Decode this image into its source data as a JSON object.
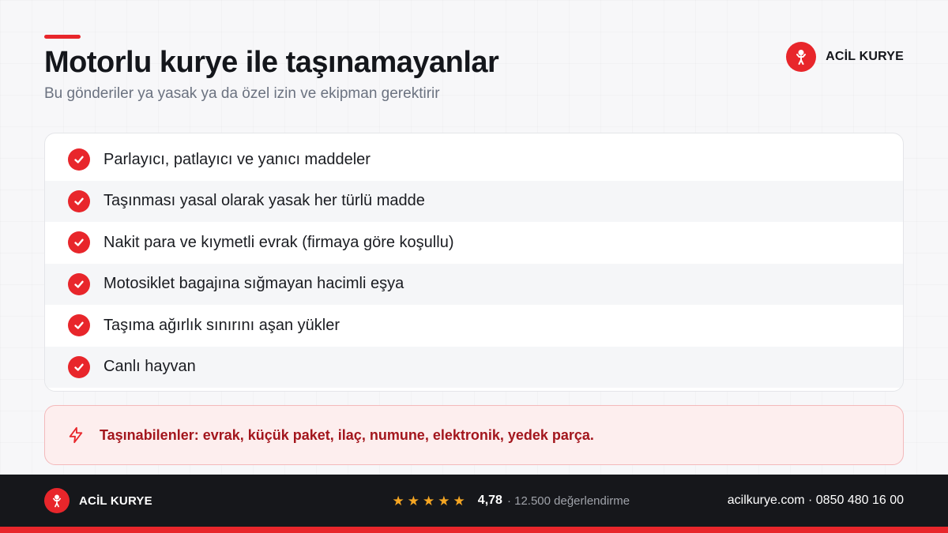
{
  "header": {
    "title": "Motorlu kurye ile taşınamayanlar",
    "subtitle": "Bu gönderiler ya yasak ya da özel izin ve ekipman gerektirir"
  },
  "brand": {
    "name": "ACİL KURYE",
    "logo_icon": "courier-person-icon"
  },
  "list": {
    "items": [
      "Parlayıcı, patlayıcı ve yanıcı maddeler",
      "Taşınması yasal olarak yasak her türlü madde",
      "Nakit para ve kıymetli evrak (firmaya göre koşullu)",
      "Motosiklet bagajına sığmayan hacimli eşya",
      "Taşıma ağırlık sınırını aşan yükler",
      "Canlı hayvan"
    ],
    "item_icon": "check-circle-icon"
  },
  "note": {
    "icon": "lightning-bolt-icon",
    "text": "Taşınabilenler: evrak, küçük paket, ilaç, numune, elektronik, yedek parça."
  },
  "footer": {
    "brand_name": "ACİL KURYE",
    "rating_stars": 5,
    "rating_value": "4,78",
    "rating_count": "· 12.500 değerlendirme",
    "contact": "acilkurye.com · 0850 480 16 00"
  },
  "colors": {
    "accent": "#e8262b",
    "note_text": "#a3161d",
    "note_bg": "#fdeeee",
    "footer_bg": "#16171b",
    "star": "#f5a623"
  }
}
